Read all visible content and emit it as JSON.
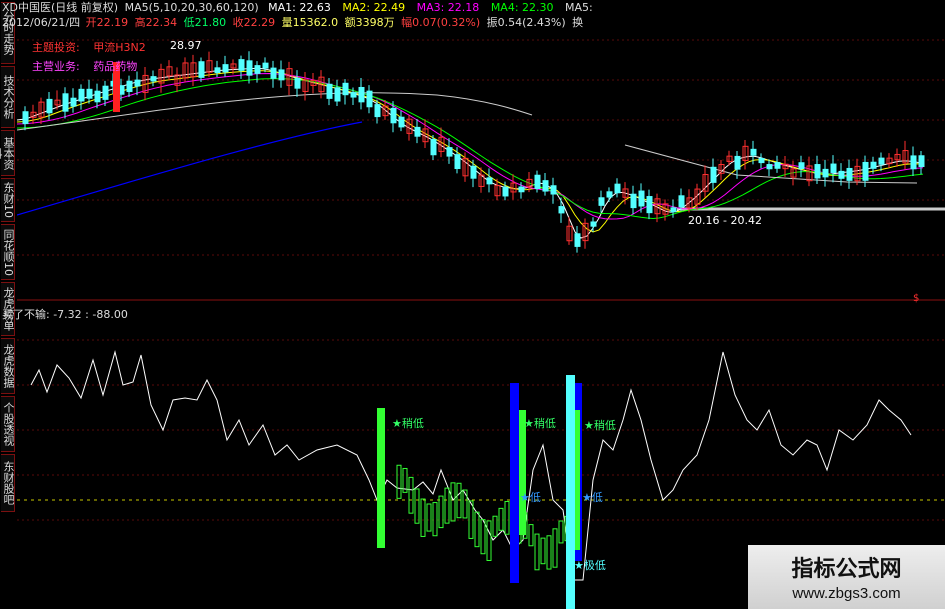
{
  "header": {
    "title": "XD中国医(日线 前复权)",
    "ma_params": "MA5(5,10,20,30,60,120)",
    "ma1": "MA1: 22.63",
    "ma2": "MA2: 22.49",
    "ma3": "MA3: 22.18",
    "ma4": "MA4: 22.30",
    "ma5": "MA5:",
    "date": "2012/06/21/四",
    "open": "开22.19",
    "high": "高22.34",
    "low": "低21.80",
    "close": "收22.29",
    "volume": "量15362.0",
    "amount": "额3398万",
    "change": "幅0.07(0.32%)",
    "amplitude": "振0.54(2.43%)",
    "more": "换"
  },
  "info": {
    "main_topic_label": "主题投资:",
    "main_topic_value": "甲流H3N2",
    "main_business_label": "主营业务:",
    "main_business_value": "药品药物",
    "price_tag": "28.97",
    "low_range": "20.16 - 20.42"
  },
  "indicator": {
    "title": "买了不输",
    "readout": "买了不输: -7.32 : -88.00",
    "labels": [
      "稍低",
      "稍低",
      "稍低",
      "低",
      "低",
      "极低"
    ]
  },
  "sidebar": {
    "tabs": [
      "分时走势",
      "技术分析",
      "基本资料",
      "东财10",
      "同花顺10",
      "龙虎榜单",
      "龙虎数据",
      "个股透视",
      "东财股吧"
    ]
  },
  "watermark": {
    "title": "指标公式网",
    "url": "www.zbgs3.com"
  },
  "colors": {
    "up": "#ff3030",
    "down": "#54ffff",
    "ma1": "#ffffff",
    "ma2": "#ffff00",
    "ma3": "#ff00ff",
    "ma4": "#00ff00",
    "ma5": "#0000ff",
    "osc": "#ffffff",
    "bar_green": "#33ff33",
    "bar_blue": "#0000ff",
    "bar_cyan": "#54ffff"
  }
}
